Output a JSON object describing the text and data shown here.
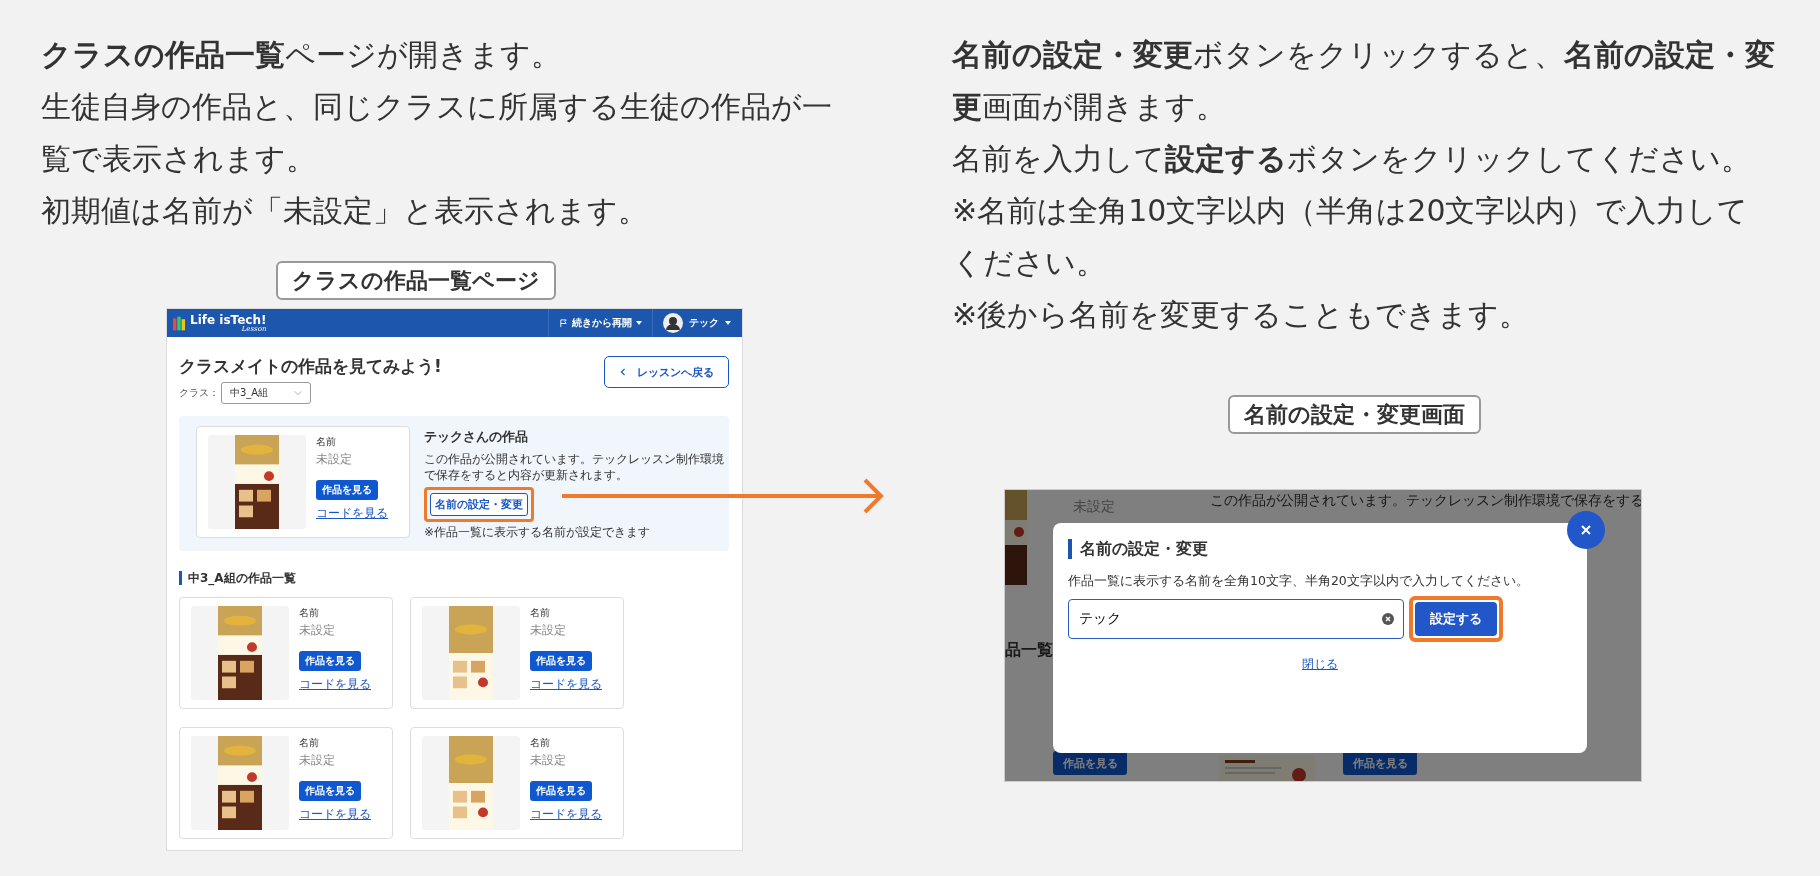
{
  "left": {
    "intro": [
      "**クラスの作品一覧**ページが開きます。",
      "生徒自身の作品と、同じクラスに所属する生徒の作品が一覧で表示されます。",
      "初期値は名前が「未設定」と表示されます。"
    ],
    "caption": "クラスの作品一覧ページ",
    "screenshot": {
      "header": {
        "logo": "Life isTech!",
        "logo_sub": "Lesson",
        "resume": "続きから再開",
        "user": "テック"
      },
      "title": "クラスメイトの作品を見てみよう!",
      "back_button": "レッスンへ戻る",
      "class_label": "クラス：",
      "class_select": "中3_A組",
      "my_work": {
        "name_label": "名前",
        "name": "未設定",
        "view_button": "作品を見る",
        "code_link": "コードを見る",
        "heading": "テックさんの作品",
        "description": "この作品が公開されています。テックレッスン制作環境で保存をすると内容が更新されます。",
        "name_button": "名前の設定・変更",
        "highlighted": true,
        "note": "※作品一覧に表示する名前が設定できます"
      },
      "list_heading": "中3_A組の作品一覧",
      "works": [
        {
          "name_label": "名前",
          "name": "未設定",
          "view_button": "作品を見る",
          "code_link": "コードを見る"
        },
        {
          "name_label": "名前",
          "name": "未設定",
          "view_button": "作品を見る",
          "code_link": "コードを見る"
        },
        {
          "name_label": "名前",
          "name": "未設定",
          "view_button": "作品を見る",
          "code_link": "コードを見る"
        },
        {
          "name_label": "名前",
          "name": "未設定",
          "view_button": "作品を見る",
          "code_link": "コードを見る"
        }
      ]
    }
  },
  "right": {
    "intro": [
      "**名前の設定・変更**ボタンをクリックすると、**名前の設定・変更**画面が開きます。",
      "名前を入力して**設定する**ボタンをクリックしてください。",
      "※名前は全角10文字以内（半角は20文字以内）で入力してください。",
      "※後から名前を変更することもできます。"
    ],
    "caption": "名前の設定・変更画面",
    "screenshot": {
      "background": {
        "name": "未設定",
        "description": "この作品が公開されています。テックレッスン制作環境で保存をする",
        "list_heading": "品一覧",
        "view_buttons": [
          "作品を見る",
          "作品を見る"
        ]
      },
      "dialog": {
        "title": "名前の設定・変更",
        "instruction": "作品一覧に表示する名前を全角10文字、半角20文字以内で入力してください。",
        "input_value": "テック",
        "submit_button": "設定する",
        "submit_highlighted": true,
        "close_link": "閉じる"
      }
    }
  }
}
